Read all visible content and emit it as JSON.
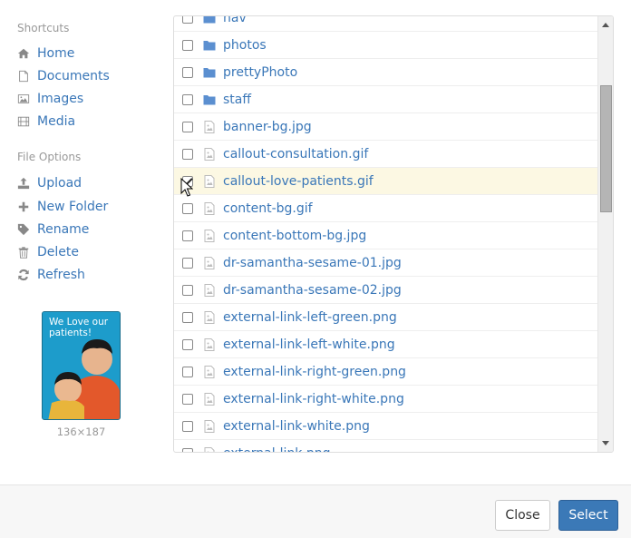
{
  "sidebar": {
    "shortcuts_title": "Shortcuts",
    "shortcuts": [
      {
        "label": "Home",
        "icon": "home-icon"
      },
      {
        "label": "Documents",
        "icon": "document-icon"
      },
      {
        "label": "Images",
        "icon": "image-icon"
      },
      {
        "label": "Media",
        "icon": "film-icon"
      }
    ],
    "file_options_title": "File Options",
    "file_options": [
      {
        "label": "Upload",
        "icon": "upload-icon"
      },
      {
        "label": "New Folder",
        "icon": "plus-icon"
      },
      {
        "label": "Rename",
        "icon": "tag-icon"
      },
      {
        "label": "Delete",
        "icon": "trash-icon"
      },
      {
        "label": "Refresh",
        "icon": "refresh-icon"
      }
    ],
    "preview": {
      "caption": "We Love our patients!",
      "dimensions": "136×187"
    }
  },
  "files": [
    {
      "name": "nav",
      "type": "folder",
      "checked": false
    },
    {
      "name": "photos",
      "type": "folder",
      "checked": false
    },
    {
      "name": "prettyPhoto",
      "type": "folder",
      "checked": false
    },
    {
      "name": "staff",
      "type": "folder",
      "checked": false
    },
    {
      "name": "banner-bg.jpg",
      "type": "image",
      "checked": false
    },
    {
      "name": "callout-consultation.gif",
      "type": "image",
      "checked": false
    },
    {
      "name": "callout-love-patients.gif",
      "type": "image",
      "checked": true
    },
    {
      "name": "content-bg.gif",
      "type": "image",
      "checked": false
    },
    {
      "name": "content-bottom-bg.jpg",
      "type": "image",
      "checked": false
    },
    {
      "name": "dr-samantha-sesame-01.jpg",
      "type": "image",
      "checked": false
    },
    {
      "name": "dr-samantha-sesame-02.jpg",
      "type": "image",
      "checked": false
    },
    {
      "name": "external-link-left-green.png",
      "type": "image",
      "checked": false
    },
    {
      "name": "external-link-left-white.png",
      "type": "image",
      "checked": false
    },
    {
      "name": "external-link-right-green.png",
      "type": "image",
      "checked": false
    },
    {
      "name": "external-link-right-white.png",
      "type": "image",
      "checked": false
    },
    {
      "name": "external-link-white.png",
      "type": "image",
      "checked": false
    },
    {
      "name": "external-link.png",
      "type": "image",
      "checked": false
    }
  ],
  "footer": {
    "close_label": "Close",
    "select_label": "Select"
  },
  "colors": {
    "link": "#3a77b8",
    "folder": "#5b8fd0",
    "selected_row": "#fcf8e3",
    "primary_button": "#3b79b7"
  }
}
